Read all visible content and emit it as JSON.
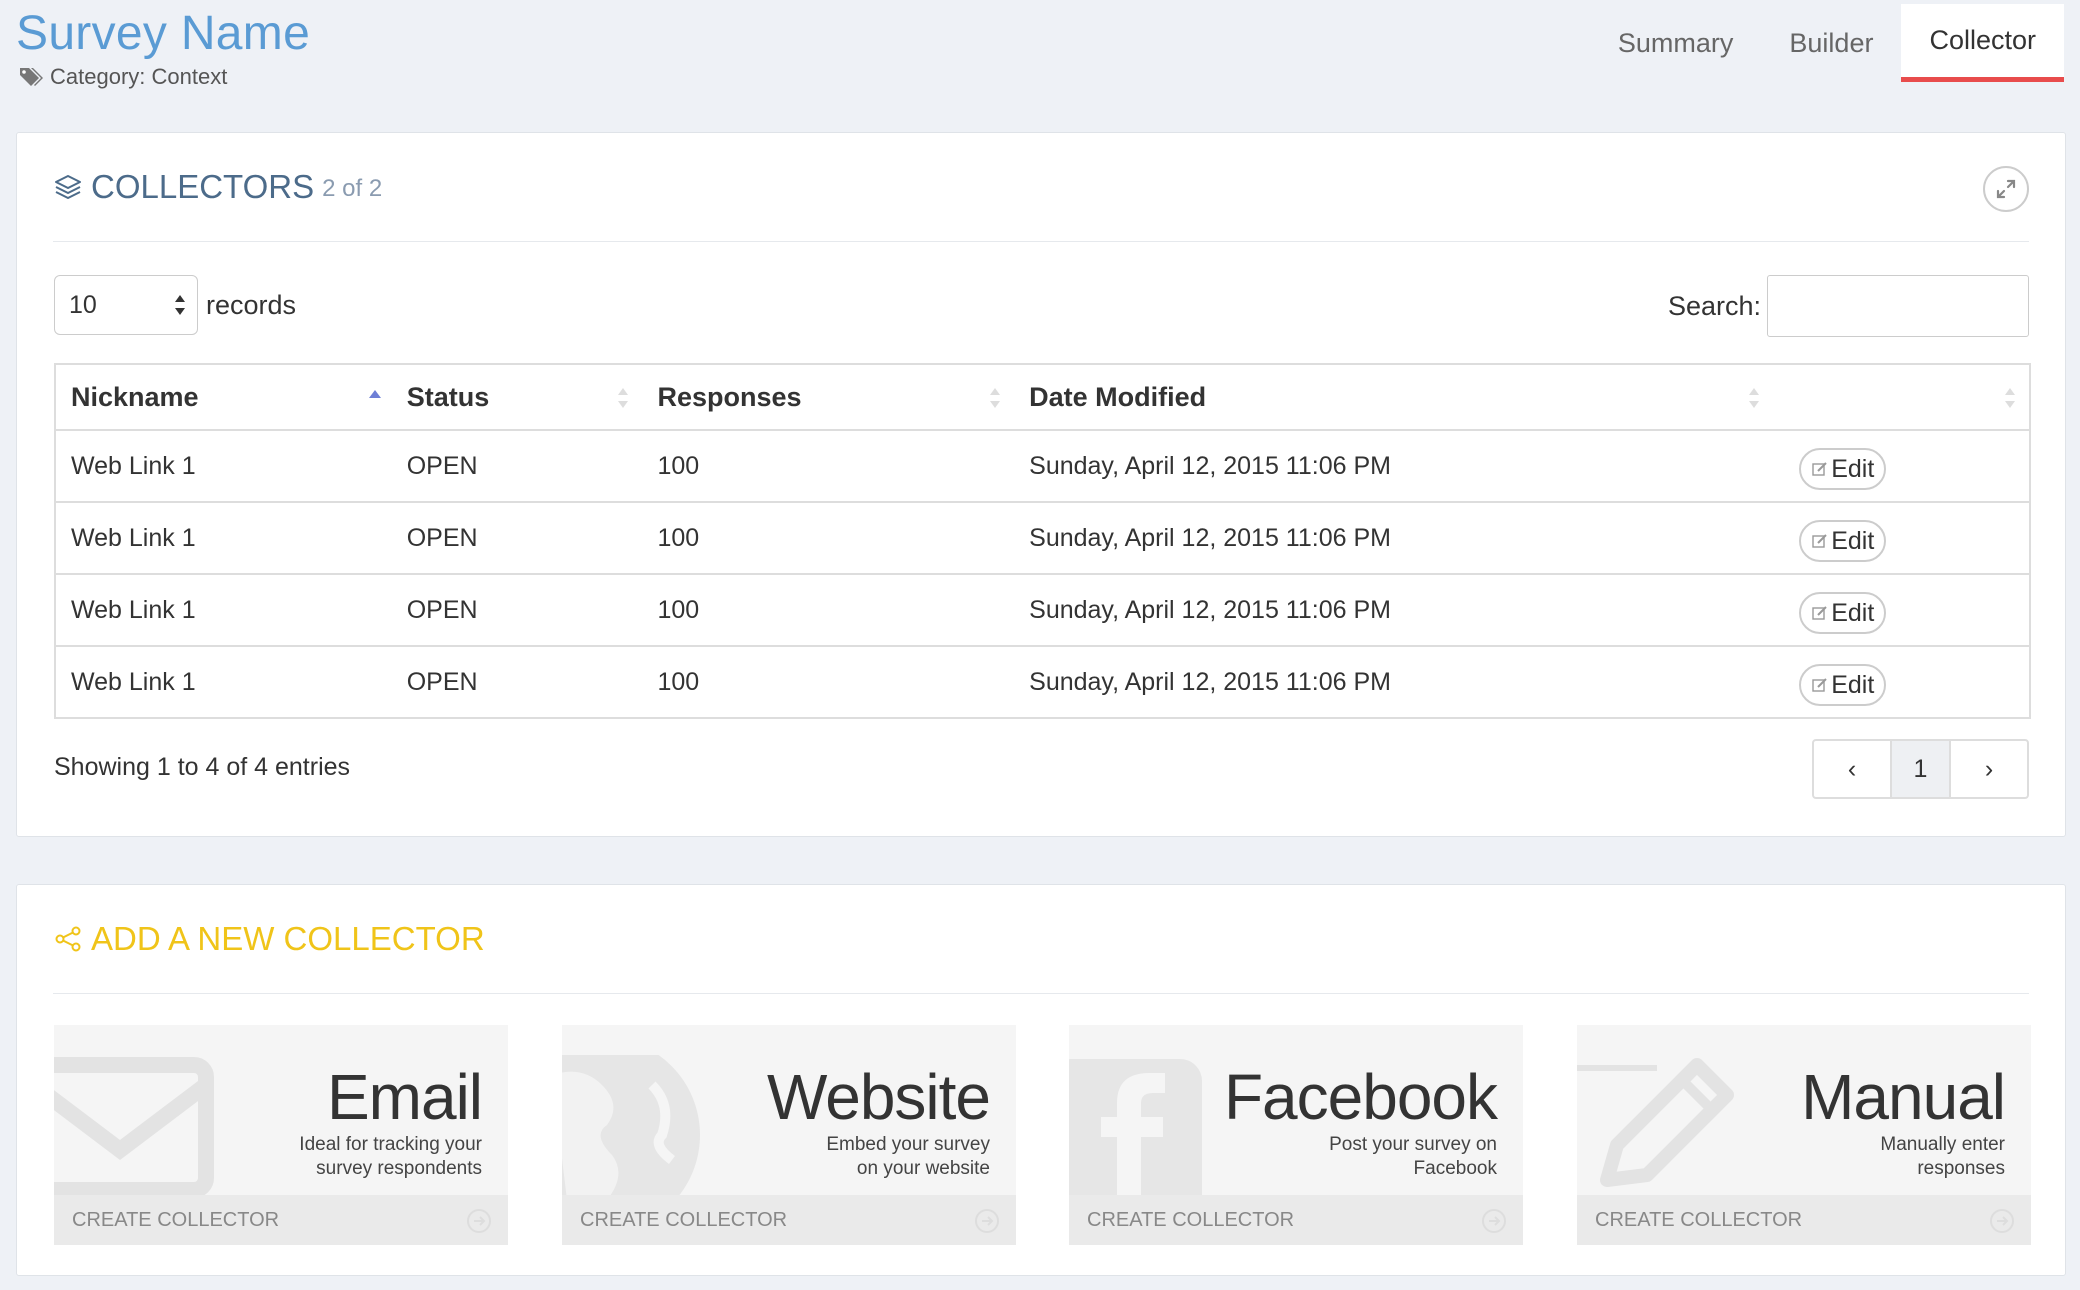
{
  "header": {
    "title": "Survey Name",
    "category": "Category: Context",
    "tabs": [
      {
        "label": "Summary",
        "active": false
      },
      {
        "label": "Builder",
        "active": false
      },
      {
        "label": "Collector",
        "active": true
      }
    ],
    "accent_color": "#e84c4c",
    "title_color": "#5a9bd4"
  },
  "collectors": {
    "title": "COLLECTORS",
    "count": "2 of 2",
    "records_value": "10",
    "records_label": "records",
    "search_label": "Search:",
    "search_value": "",
    "columns": [
      "Nickname",
      "Status",
      "Responses",
      "Date Modified",
      ""
    ],
    "rows": [
      {
        "nickname": "Web Link 1",
        "status": "OPEN",
        "responses": "100",
        "date": "Sunday, April 12, 2015 11:06 PM",
        "action": "Edit"
      },
      {
        "nickname": "Web Link 1",
        "status": "OPEN",
        "responses": "100",
        "date": "Sunday, April 12, 2015 11:06 PM",
        "action": "Edit"
      },
      {
        "nickname": "Web Link 1",
        "status": "OPEN",
        "responses": "100",
        "date": "Sunday, April 12, 2015 11:06 PM",
        "action": "Edit"
      },
      {
        "nickname": "Web Link 1",
        "status": "OPEN",
        "responses": "100",
        "date": "Sunday, April 12, 2015 11:06 PM",
        "action": "Edit"
      }
    ],
    "showing": "Showing 1 to 4 of 4 entries",
    "pagination": {
      "prev": "‹",
      "page": "1",
      "next": "›"
    }
  },
  "add_collector": {
    "title": "ADD A NEW COLLECTOR",
    "title_color": "#f0c419",
    "cards": [
      {
        "name": "Email",
        "desc_line1": "Ideal for tracking your",
        "desc_line2": "survey respondents",
        "action": "CREATE COLLECTOR",
        "icon": "envelope-icon"
      },
      {
        "name": "Website",
        "desc_line1": "Embed your survey",
        "desc_line2": "on your website",
        "action": "CREATE COLLECTOR",
        "icon": "globe-icon"
      },
      {
        "name": "Facebook",
        "desc_line1": "Post your survey on",
        "desc_line2": "Facebook",
        "action": "CREATE COLLECTOR",
        "icon": "facebook-icon"
      },
      {
        "name": "Manual",
        "desc_line1": "Manually enter",
        "desc_line2": "responses",
        "action": "CREATE COLLECTOR",
        "icon": "pencil-icon"
      }
    ]
  }
}
